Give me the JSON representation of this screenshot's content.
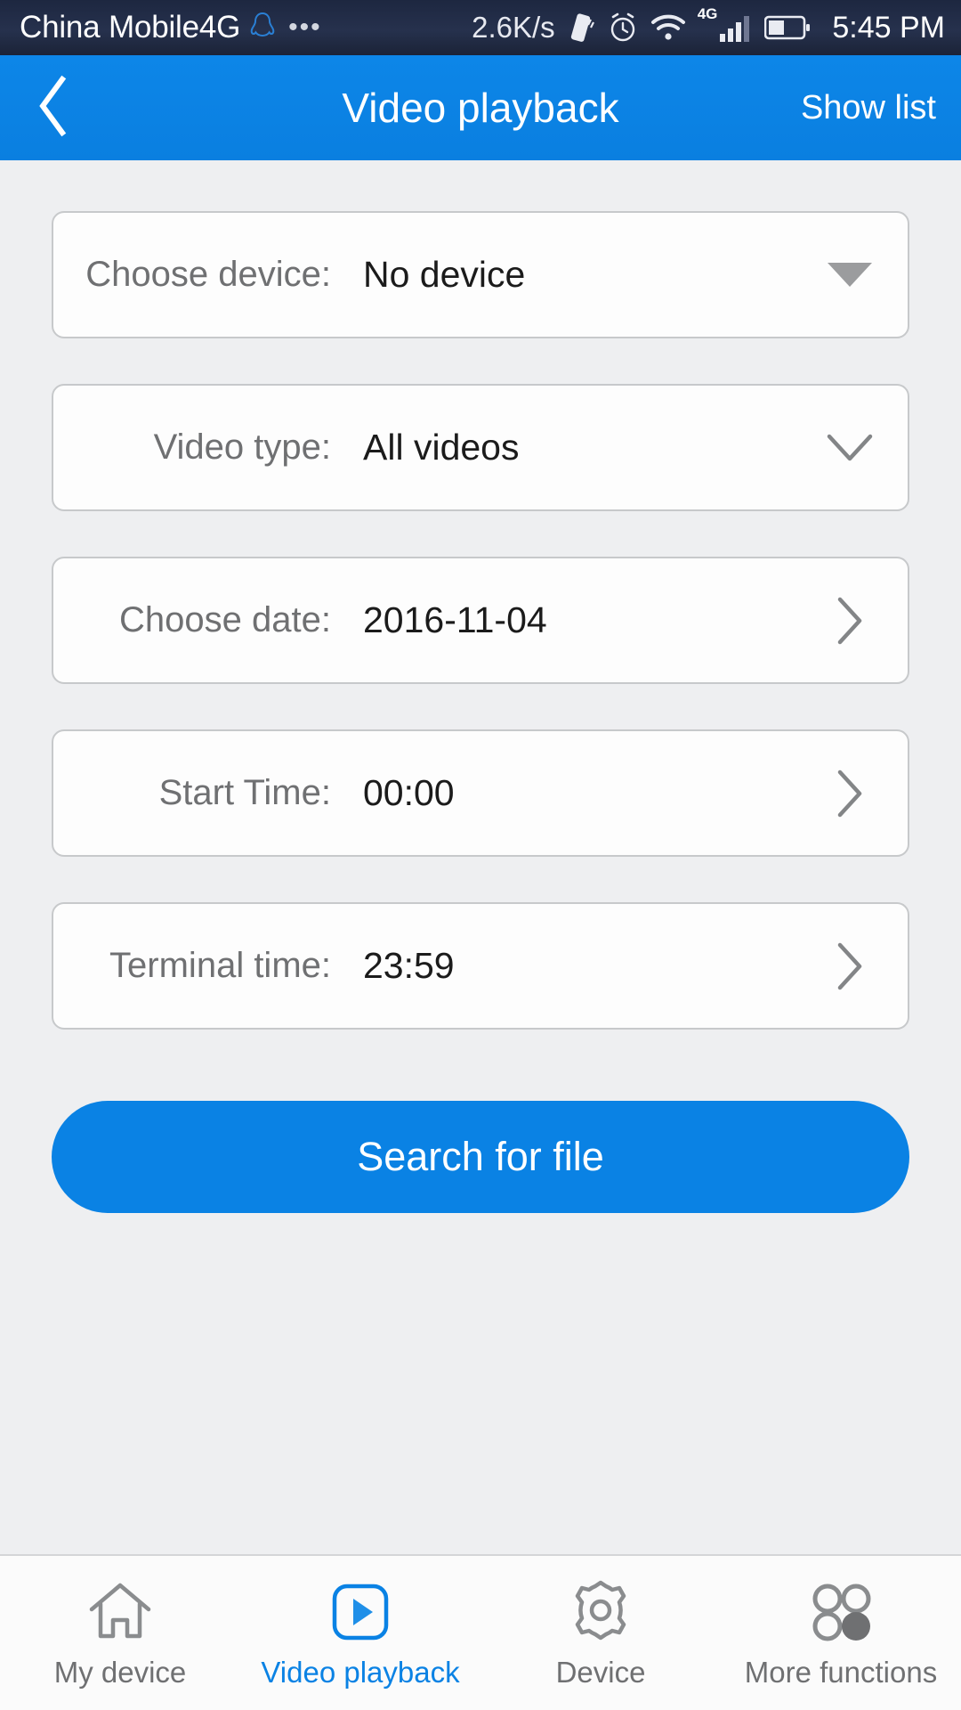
{
  "statusbar": {
    "carrier": "China Mobile4G",
    "qq_icon": "qq-penguin-icon",
    "overflow_icon": "more-dots-icon",
    "network_speed": "2.6K/s",
    "vibrate_icon": "vibrate-icon",
    "alarm_icon": "alarm-clock-icon",
    "wifi_icon": "wifi-icon",
    "network_type": "4G",
    "signal_icon": "signal-bars-icon",
    "battery_icon": "battery-icon",
    "time": "5:45 PM"
  },
  "header": {
    "back_icon": "chevron-left-icon",
    "title": "Video playback",
    "action_label": "Show list"
  },
  "form": {
    "rows": [
      {
        "label": "Choose device:",
        "value": "No device",
        "indicator": "triangle-down-icon"
      },
      {
        "label": "Video type:",
        "value": "All videos",
        "indicator": "chevron-down-icon"
      },
      {
        "label": "Choose date:",
        "value": "2016-11-04",
        "indicator": "chevron-right-icon"
      },
      {
        "label": "Start Time:",
        "value": "00:00",
        "indicator": "chevron-right-icon"
      },
      {
        "label": "Terminal time:",
        "value": "23:59",
        "indicator": "chevron-right-icon"
      }
    ],
    "submit_label": "Search for file"
  },
  "bottomnav": {
    "items": [
      {
        "label": "My device",
        "icon": "home-icon",
        "active": false
      },
      {
        "label": "Video playback",
        "icon": "play-square-icon",
        "active": true
      },
      {
        "label": "Device",
        "icon": "gear-icon",
        "active": false
      },
      {
        "label": "More functions",
        "icon": "four-circles-icon",
        "active": false
      }
    ]
  },
  "colors": {
    "accent": "#0a82e4",
    "page_bg": "#eeeff1",
    "card_bg": "#fdfdfd",
    "card_border": "#c7c9cb",
    "label_text": "#6f7072",
    "value_text": "#1b1b1b",
    "statusbar_bg": "#26314d"
  }
}
